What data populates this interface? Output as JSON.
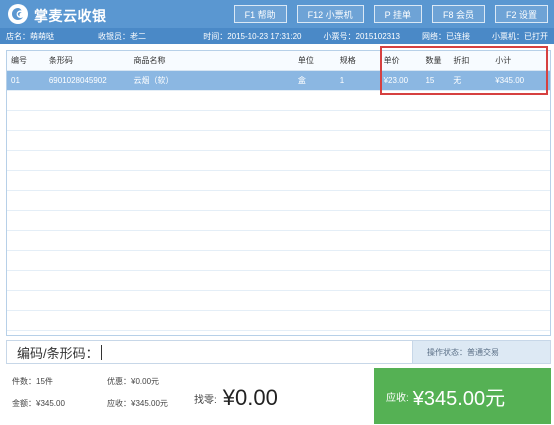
{
  "app": {
    "title": "掌麦云收银"
  },
  "hotkeys": [
    {
      "label": "F1 帮助"
    },
    {
      "label": "F12 小票机"
    },
    {
      "label": "P 挂单"
    },
    {
      "label": "F8 会员"
    },
    {
      "label": "F2 设置"
    }
  ],
  "info": {
    "store": "店名：萌萌哒",
    "cashier": "收银员：老二",
    "time": "时间：2015-10-23 17:31:20",
    "ticket": "小票号：2015102313",
    "network": "网络：已连接",
    "printer": "小票机：已打开"
  },
  "table": {
    "headers": {
      "no": "编号",
      "barcode": "条形码",
      "name": "商品名称",
      "unit": "单位",
      "spec": "规格",
      "price": "单价",
      "qty": "数量",
      "discount": "折扣",
      "subtotal": "小计"
    },
    "rows": [
      {
        "no": "01",
        "barcode": "6901028045902",
        "name": "云烟（软）",
        "unit": "盒",
        "spec": "1",
        "price": "¥23.00",
        "qty": "15",
        "discount": "无",
        "subtotal": "¥345.00"
      }
    ]
  },
  "input": {
    "label": "编码/条形码："
  },
  "status": {
    "text": "操作状态：普通交易"
  },
  "summary": {
    "count": "件数：15件",
    "discount": "优惠：¥0.00元",
    "amount": "金额：¥345.00",
    "receivable": "应收：¥345.00元"
  },
  "change": {
    "label": "找零:",
    "value": "¥0.00"
  },
  "due": {
    "label": "应收:",
    "value": "¥345.00元"
  },
  "colors": {
    "header": "#5a97d1",
    "infobar": "#4a89c7",
    "selected_row": "#8bb7e2",
    "due_panel": "#55b154",
    "highlight": "#d64040"
  }
}
